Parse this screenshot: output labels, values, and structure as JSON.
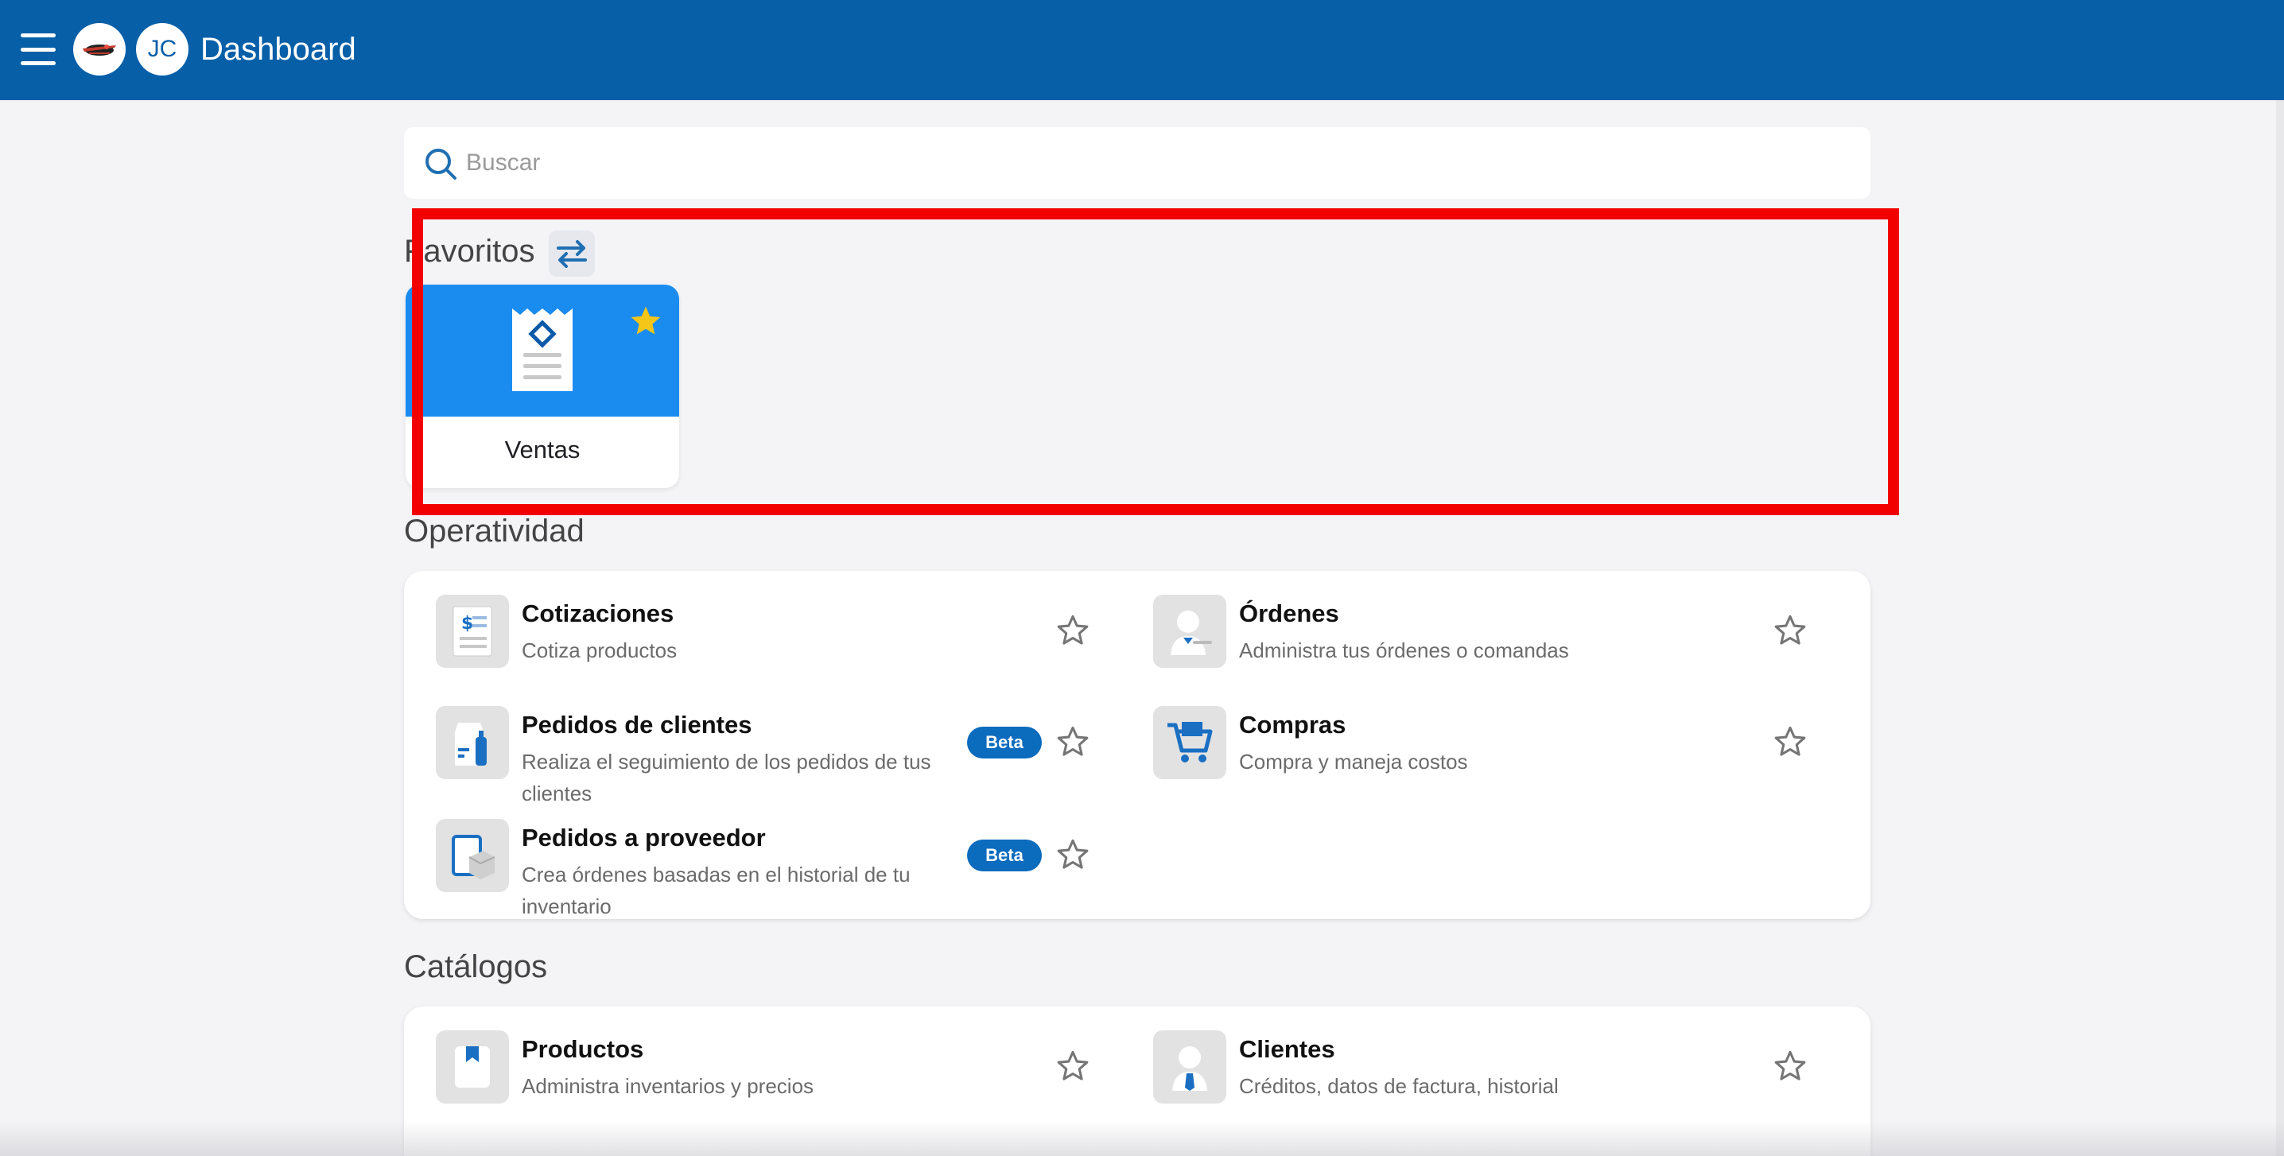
{
  "header": {
    "title": "Dashboard",
    "avatar_initials": "JC",
    "background": "#075fa8"
  },
  "search": {
    "placeholder": "Buscar",
    "value": ""
  },
  "favorites": {
    "title": "Favoritos",
    "items": [
      {
        "label": "Ventas",
        "icon": "receipt-icon",
        "starred": true
      }
    ]
  },
  "operatividad": {
    "title": "Operatividad",
    "items": [
      {
        "name": "Cotizaciones",
        "desc": "Cotiza productos",
        "icon": "quote-document-icon",
        "beta": ""
      },
      {
        "name": "Órdenes",
        "desc": "Administra tus órdenes o comandas",
        "icon": "waiter-icon",
        "beta": ""
      },
      {
        "name": "Pedidos de clientes",
        "desc": "Realiza el seguimiento de los pedidos de tus clientes",
        "icon": "customer-orders-icon",
        "beta": "Beta"
      },
      {
        "name": "Compras",
        "desc": "Compra y maneja costos",
        "icon": "shopping-cart-icon",
        "beta": ""
      },
      {
        "name": "Pedidos a proveedor",
        "desc": "Crea órdenes basadas en el historial de tu inventario",
        "icon": "supplier-order-icon",
        "beta": "Beta"
      }
    ]
  },
  "catalogos": {
    "title": "Catálogos",
    "items": [
      {
        "name": "Productos",
        "desc": "Administra inventarios y precios",
        "icon": "product-tag-icon"
      },
      {
        "name": "Clientes",
        "desc": "Créditos, datos de factura, historial",
        "icon": "client-icon"
      }
    ]
  },
  "colors": {
    "accent": "#1a8cf0",
    "beta": "#0b6bbd",
    "star_active": "#f5c518",
    "highlight": "#f20000"
  }
}
